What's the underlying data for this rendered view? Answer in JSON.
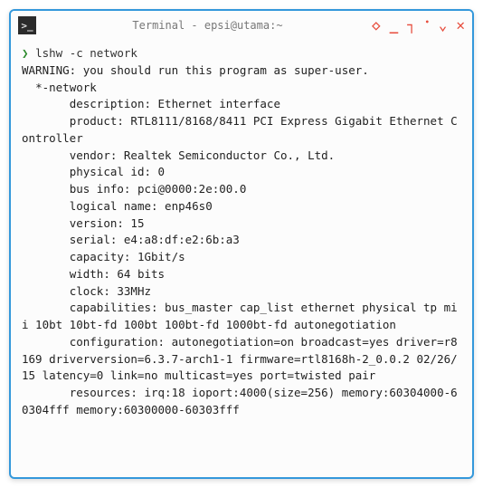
{
  "window": {
    "title": "Terminal - epsi@utama:~",
    "icon_glyph": ">_"
  },
  "controls": {
    "pin": "◇",
    "minimize": "_",
    "maximize": "┐",
    "dot": "•",
    "menu": "⌄",
    "close": "✕"
  },
  "terminal": {
    "prompt": "❯",
    "command": "lshw -c network",
    "output": "WARNING: you should run this program as super-user.\n  *-network\n       description: Ethernet interface\n       product: RTL8111/8168/8411 PCI Express Gigabit Ethernet Controller\n       vendor: Realtek Semiconductor Co., Ltd.\n       physical id: 0\n       bus info: pci@0000:2e:00.0\n       logical name: enp46s0\n       version: 15\n       serial: e4:a8:df:e2:6b:a3\n       capacity: 1Gbit/s\n       width: 64 bits\n       clock: 33MHz\n       capabilities: bus_master cap_list ethernet physical tp mii 10bt 10bt-fd 100bt 100bt-fd 1000bt-fd autonegotiation\n       configuration: autonegotiation=on broadcast=yes driver=r8169 driverversion=6.3.7-arch1-1 firmware=rtl8168h-2_0.0.2 02/26/15 latency=0 link=no multicast=yes port=twisted pair\n       resources: irq:18 ioport:4000(size=256) memory:60304000-60304fff memory:60300000-60303fff"
  }
}
